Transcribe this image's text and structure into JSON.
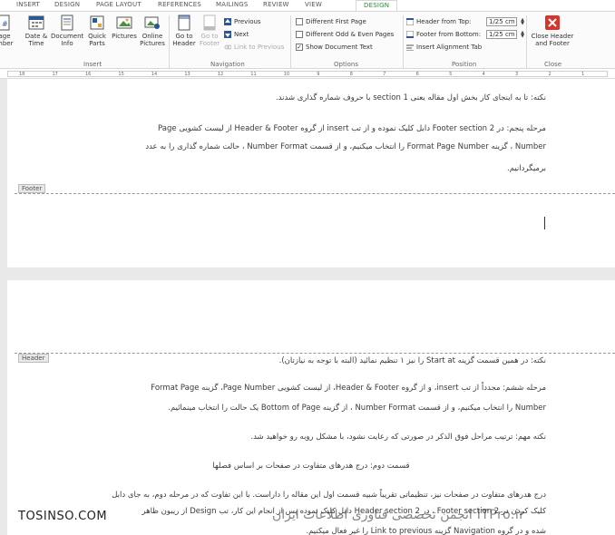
{
  "ribbon_tabs": [
    "INSERT",
    "DESIGN",
    "PAGE LAYOUT",
    "REFERENCES",
    "MAILINGS",
    "REVIEW",
    "VIEW"
  ],
  "active_tab": "DESIGN",
  "insert_group": {
    "page_number": "age\nmber",
    "date_time": "Date &\nTime",
    "document_info": "Document\nInfo",
    "quick_parts": "Quick\nParts",
    "pictures": "Pictures",
    "online_pictures": "Online\nPictures",
    "label": "Insert"
  },
  "navigation_group": {
    "goto_header": "Go to\nHeader",
    "goto_footer": "Go to\nFooter",
    "previous": "Previous",
    "next": "Next",
    "link_to_previous": "Link to Previous",
    "label": "Navigation"
  },
  "options_group": {
    "different_first_page": "Different First Page",
    "different_odd_even": "Different Odd & Even Pages",
    "show_document_text": "Show Document Text",
    "label": "Options"
  },
  "position_group": {
    "header_from_top": "Header from Top:",
    "header_from_top_value": "1/25 cm",
    "footer_from_bottom": "Footer from Bottom:",
    "footer_from_bottom_value": "1/25 cm",
    "insert_alignment_tab": "Insert Alignment Tab",
    "label": "Position"
  },
  "close_group": {
    "close_label": "Close Header\nand Footer",
    "label": "Close"
  },
  "ruler_numbers": [
    "18",
    "17",
    "16",
    "15",
    "14",
    "13",
    "12",
    "11",
    "10",
    "9",
    "8",
    "7",
    "6",
    "5",
    "4",
    "3",
    "2",
    "1"
  ],
  "page1": {
    "line1": "نکته: تا به اینجای کار بخش اول مقاله یعنی section 1 با حروف شماره گذاری شدند.",
    "line2": "مرحله پنجم: در Footer section 2 دابل کلیک نموده و از تب insert از گروه Header & Footer از لیست کشویی Page",
    "line3": "Number ، گزینه Format Page Number را انتخاب میکنیم، و از قسمت Number Format ، حالت شماره گذاری را به عدد",
    "line4": "برمیگردانیم.",
    "footer_label": "Footer"
  },
  "page2": {
    "header_label": "Header",
    "line1": "نکته: در همین قسمت گزینه Start at را نیز ۱ تنظیم نمائید (البته با توجه به نیازتان).",
    "line2": "مرحله ششم: مجدداً از تب insert، و از گروه Header & Footer، از لیست کشویی Page Number، گزینه Format Page",
    "line3": "Number را انتخاب میکنیم، و از قسمت Number Format ، از گزینه Bottom of Page یک حالت را انتخاب مینمائیم.",
    "line4": "نکته مهم: ترتیب مراحل فوق الذکر در صورتی که رعایت نشود، با مشکل روبه رو خواهید شد.",
    "line5": "قسمت دوم: درج هدرهای متفاوت در صفحات بر اساس فصلها",
    "line6": "درج هدرهای متفاوت در صفحات نیز، تنظیماتی تقریباً شبیه قسمت اول این مقاله را داراست. با این تفاوت که در مرحله دوم، به جای دابل",
    "line7": "کلیک کردن در Footer section 2 ، در Header section 2 دابل کلیک نموده پس از انجام این کار، تب Design از ریبون ظاهر",
    "line8": "شده و در گروه Navigation گزینه Link to previous را غیر فعال میکنیم."
  },
  "watermark": {
    "left_text": "TOSINSO.COM",
    "right_text": "ITPro.ir انجمن تخصصی فناوری اطلاعات ایران"
  }
}
